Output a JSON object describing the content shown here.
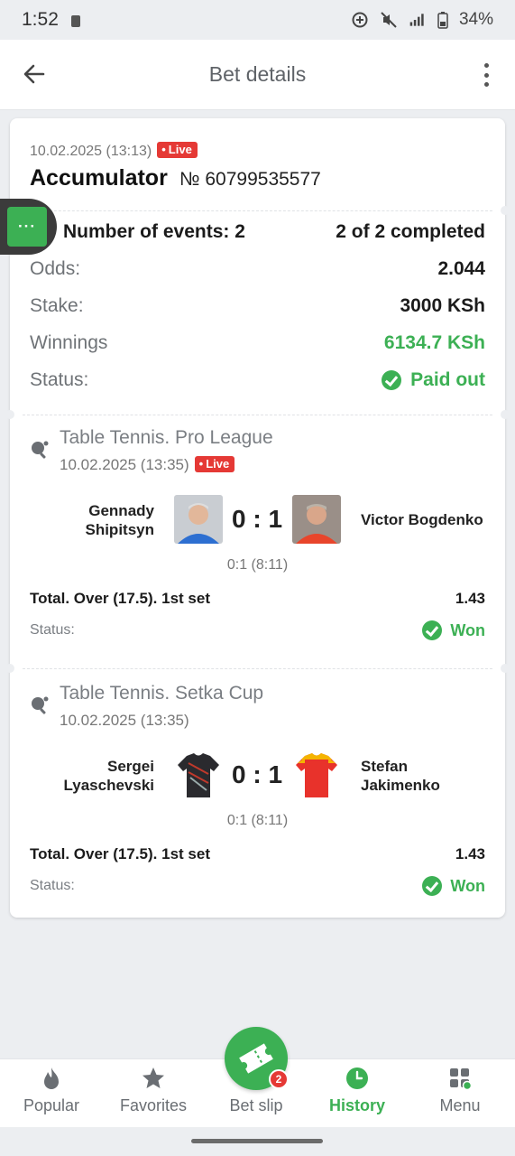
{
  "status_bar": {
    "time": "1:52",
    "battery": "34%",
    "network": "LTE"
  },
  "header": {
    "title": "Bet details"
  },
  "bet": {
    "date": "10.02.2025 (13:13)",
    "live_label": "Live",
    "type": "Accumulator",
    "number": "№ 60799535577",
    "events_label": "Number of events: 2",
    "completed": "2 of 2 completed",
    "odds_label": "Odds:",
    "odds_value": "2.044",
    "stake_label": "Stake:",
    "stake_value": "3000 KSh",
    "winnings_label": "Winnings",
    "winnings_value": "6134.7 KSh",
    "status_label": "Status:",
    "status_value": "Paid out",
    "float_tab_label": "···"
  },
  "events": [
    {
      "league": "Table Tennis. Pro League",
      "date": "10.02.2025 (13:35)",
      "live_label": "Live",
      "team1_line1": "Gennady",
      "team1_line2": "Shipitsyn",
      "team2_line1": "Victor Bogdenko",
      "team2_line2": "",
      "score": "0 : 1",
      "sets": "0:1 (8:11)",
      "market": "Total. Over (17.5). 1st set",
      "odds": "1.43",
      "status_label": "Status:",
      "status_value": "Won"
    },
    {
      "league": "Table Tennis. Setka Cup",
      "date": "10.02.2025 (13:35)",
      "team1_line1": "Sergei",
      "team1_line2": "Lyaschevski",
      "team2_line1": "Stefan",
      "team2_line2": "Jakimenko",
      "score": "0 : 1",
      "sets": "0:1 (8:11)",
      "market": "Total. Over (17.5). 1st set",
      "odds": "1.43",
      "status_label": "Status:",
      "status_value": "Won"
    }
  ],
  "nav": {
    "items": [
      {
        "label": "Popular",
        "icon": "flame-icon"
      },
      {
        "label": "Favorites",
        "icon": "star-icon"
      },
      {
        "label": "Bet slip",
        "icon": "ticket-icon"
      },
      {
        "label": "History",
        "icon": "clock-icon"
      },
      {
        "label": "Menu",
        "icon": "grid-icon"
      }
    ],
    "betslip_count": "2",
    "active": "History"
  },
  "colors": {
    "accent": "#3cb054",
    "live": "#e53935",
    "background": "#eceef1"
  }
}
